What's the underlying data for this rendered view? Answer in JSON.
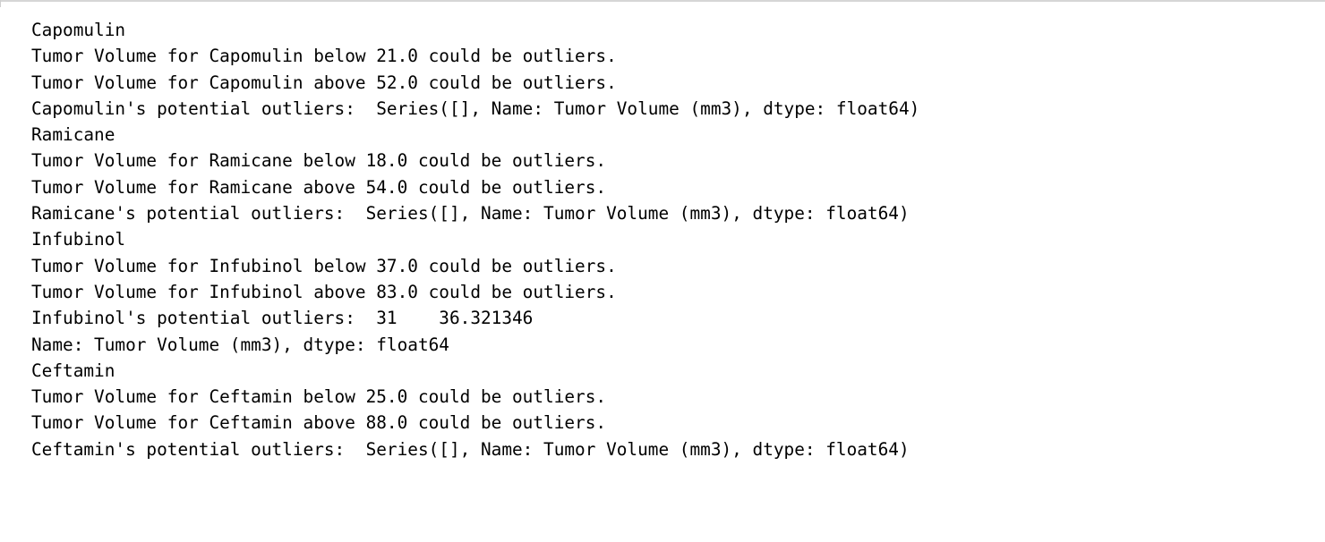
{
  "output": {
    "lines": [
      "Capomulin",
      "Tumor Volume for Capomulin below 21.0 could be outliers.",
      "Tumor Volume for Capomulin above 52.0 could be outliers.",
      "Capomulin's potential outliers:  Series([], Name: Tumor Volume (mm3), dtype: float64)",
      "Ramicane",
      "Tumor Volume for Ramicane below 18.0 could be outliers.",
      "Tumor Volume for Ramicane above 54.0 could be outliers.",
      "Ramicane's potential outliers:  Series([], Name: Tumor Volume (mm3), dtype: float64)",
      "Infubinol",
      "Tumor Volume for Infubinol below 37.0 could be outliers.",
      "Tumor Volume for Infubinol above 83.0 could be outliers.",
      "Infubinol's potential outliers:  31    36.321346",
      "Name: Tumor Volume (mm3), dtype: float64",
      "Ceftamin",
      "Tumor Volume for Ceftamin below 25.0 could be outliers.",
      "Tumor Volume for Ceftamin above 88.0 could be outliers.",
      "Ceftamin's potential outliers:  Series([], Name: Tumor Volume (mm3), dtype: float64)"
    ]
  }
}
